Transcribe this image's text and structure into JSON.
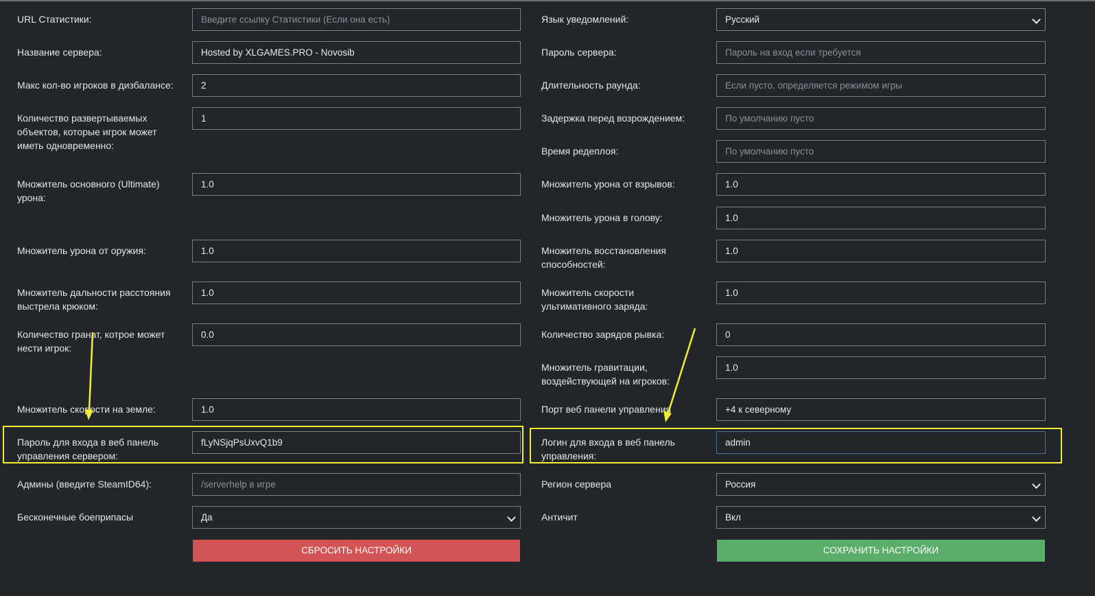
{
  "left": {
    "stats_url": {
      "label": "URL Статистики:",
      "value": "",
      "placeholder": "Введите ссылку Статистики (Если она есть)"
    },
    "server_name": {
      "label": "Название сервера:",
      "value": "Hosted by XLGAMES.PRO - Novosib"
    },
    "max_imbalance": {
      "label": "Макс кол-во игроков в дизбалансе:",
      "value": "2"
    },
    "deployables": {
      "label": "Количество развертываемых\nобъектов, которые игрок может\nиметь одновременно:",
      "value": "1"
    },
    "ultimate_mult": {
      "label": "Множитель основного (Ultimate)\nурона:",
      "value": "1.0"
    },
    "weapon_mult": {
      "label": "Множитель урона от оружия:",
      "value": "1.0"
    },
    "hook_range_mult": {
      "label": "Множитель дальности расстояния\nвыстрела крюком:",
      "value": "1.0"
    },
    "grenades": {
      "label": "Количество гранат, котрое может\nнести игрок:",
      "value": "0.0"
    },
    "ground_speed_mult": {
      "label": "Множитель скорости на земле:",
      "value": "1.0"
    },
    "web_password": {
      "label": "Пароль для входа в веб панель\nуправления сервером:",
      "value": "fLyNSjqPsUxvQ1b9"
    },
    "admins": {
      "label": "Админы (введите SteamID64):",
      "value": "",
      "placeholder": "/serverhelp в игре"
    },
    "infinite_ammo": {
      "label": "Бесконечные боеприпасы",
      "value": "Да"
    },
    "reset_button": "СБРОСИТЬ НАСТРОЙКИ"
  },
  "right": {
    "notify_lang": {
      "label": "Язык уведомлений:",
      "value": "Русский"
    },
    "server_password": {
      "label": "Пароль сервера:",
      "value": "",
      "placeholder": "Пароль на вход если требуется"
    },
    "round_length": {
      "label": "Длительность раунда:",
      "value": "",
      "placeholder": "Если пусто, определяется режимом игры"
    },
    "respawn_delay": {
      "label": "Задержка перед возрождением:",
      "value": "",
      "placeholder": "По умолчанию пусто"
    },
    "redeploy_time": {
      "label": "Время редеплоя:",
      "value": "",
      "placeholder": "По умолчанию пусто"
    },
    "explosion_mult": {
      "label": "Множитель урона от взрывов:",
      "value": "1.0"
    },
    "headshot_mult": {
      "label": "Множитель урона в голову:",
      "value": "1.0"
    },
    "cooldown_mult": {
      "label": "Множитель восстановления\nспособностей:",
      "value": "1.0"
    },
    "ult_charge_mult": {
      "label": "Множитель скорости\nультимативного заряда:",
      "value": "1.0"
    },
    "dash_charges": {
      "label": "Количество зарядов рывка:",
      "value": "0"
    },
    "gravity_mult": {
      "label": "Множитель гравитации,\nвоздействующей на игроков:",
      "value": "1.0"
    },
    "web_port": {
      "label": "Порт веб панели управления",
      "value": "+4 к северному"
    },
    "web_login": {
      "label": "Логин для входа в веб панель\nуправления:",
      "value": "admin"
    },
    "region": {
      "label": "Регион сервера",
      "value": "Россия"
    },
    "anticheat": {
      "label": "Античит",
      "value": "Вкл"
    },
    "save_button": "СОХРАНИТЬ НАСТРОЙКИ"
  },
  "colors": {
    "background": "#22252a",
    "field_border": "#7a7f85",
    "reset_button": "#d35454",
    "save_button": "#5bae6a",
    "highlight": "#f2ef2d"
  }
}
